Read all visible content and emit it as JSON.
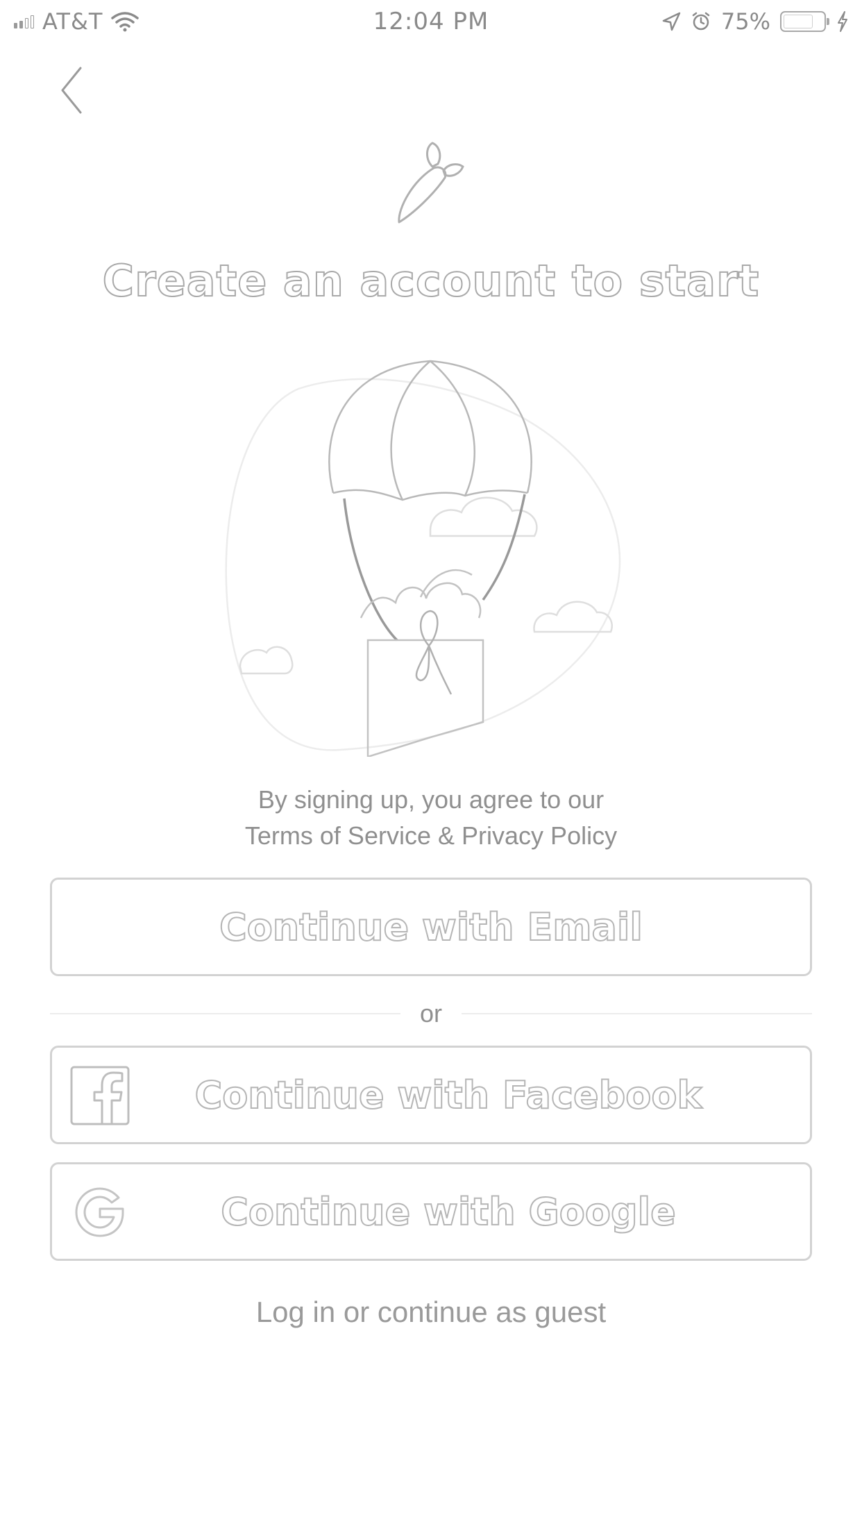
{
  "status_bar": {
    "carrier": "AT&T",
    "time": "12:04 PM",
    "battery_percent": "75%",
    "battery_level": 0.75,
    "icons": [
      "signal-icon",
      "wifi-icon",
      "location-arrow-icon",
      "alarm-icon",
      "battery-icon",
      "charging-bolt-icon"
    ]
  },
  "header": {
    "back_icon": "chevron-left-icon",
    "logo_icon": "carrot-logo-icon",
    "title": "Create an account to start"
  },
  "illustration": {
    "icon": "hot-air-balloon-groceries-illustration"
  },
  "legal": {
    "line1": "By signing up, you agree to our",
    "terms_label": "Terms of Service",
    "ampersand": "&",
    "privacy_label": "Privacy Policy"
  },
  "buttons": {
    "email_label": "Continue with Email",
    "divider_label": "or",
    "facebook_label": "Continue with Facebook",
    "facebook_icon": "facebook-icon",
    "google_label": "Continue with Google",
    "google_icon": "google-icon"
  },
  "footer": {
    "login_label": "Log in or continue as guest"
  },
  "colors": {
    "text": "#8a8a8a",
    "border": "#d2d2d2",
    "background": "#ffffff"
  }
}
